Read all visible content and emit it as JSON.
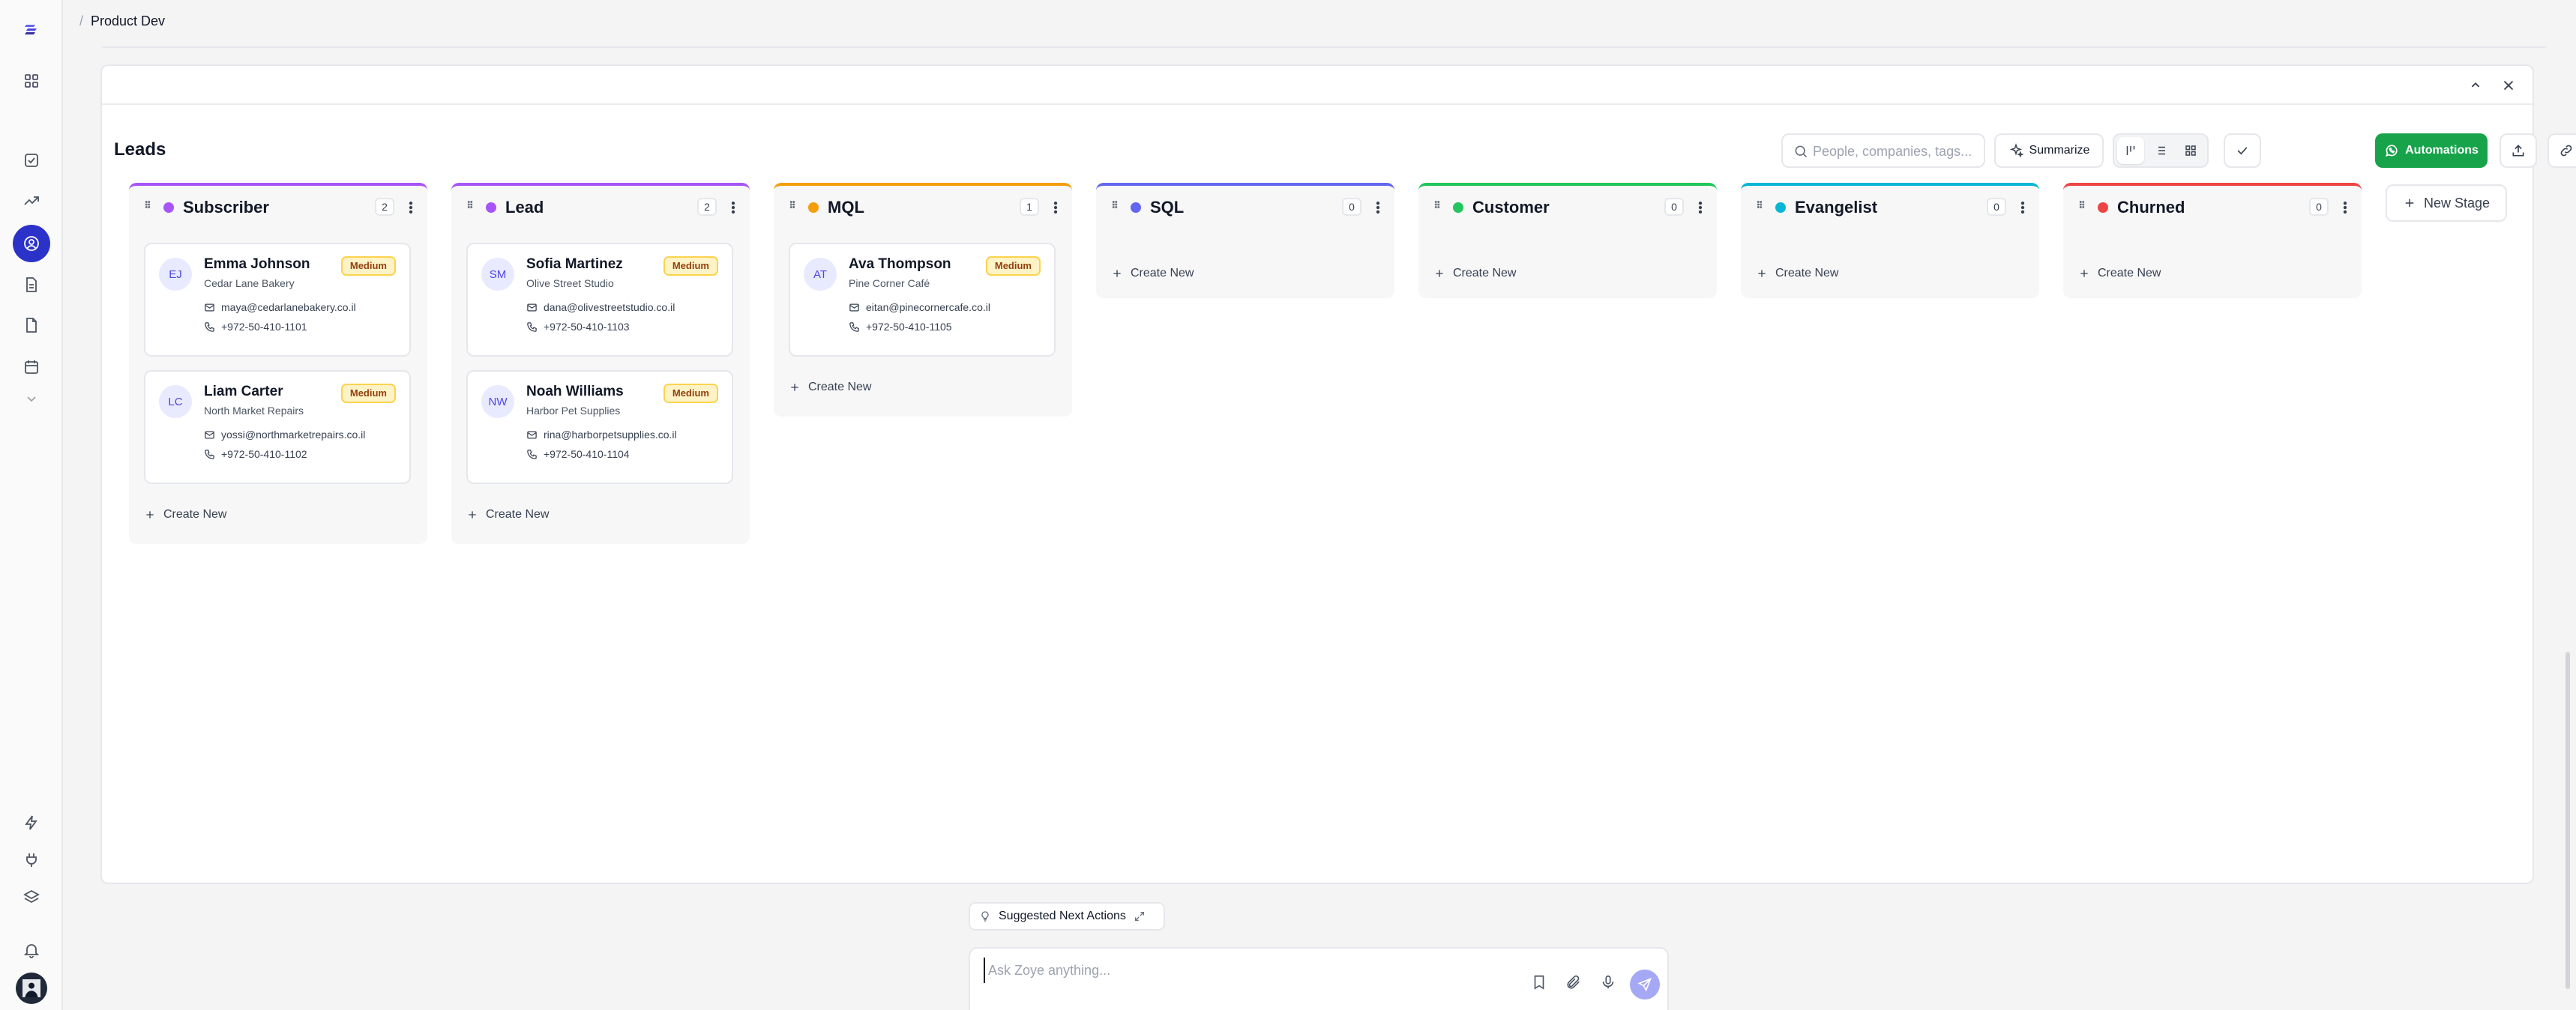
{
  "breadcrumb": {
    "separator": "/",
    "current": "Product Dev"
  },
  "page": {
    "title": "Leads"
  },
  "toolbar": {
    "search_placeholder": "People, companies, tags...",
    "summarize_label": "Summarize",
    "automations_label": "Automations",
    "automations_color": "#16a34a"
  },
  "columns": [
    {
      "name": "Subscriber",
      "count": "2",
      "color": "#a855f7",
      "cards": [
        {
          "initials": "EJ",
          "name": "Emma Johnson",
          "company": "Cedar Lane Bakery",
          "email": "maya@cedarlanebakery.co.il",
          "phone": "+972-50-410-1101",
          "priority": "Medium"
        },
        {
          "initials": "LC",
          "name": "Liam Carter",
          "company": "North Market Repairs",
          "email": "yossi@northmarketrepairs.co.il",
          "phone": "+972-50-410-1102",
          "priority": "Medium"
        }
      ],
      "create_label": "Create New"
    },
    {
      "name": "Lead",
      "count": "2",
      "color": "#a855f7",
      "cards": [
        {
          "initials": "SM",
          "name": "Sofia Martinez",
          "company": "Olive Street Studio",
          "email": "dana@olivestreetstudio.co.il",
          "phone": "+972-50-410-1103",
          "priority": "Medium"
        },
        {
          "initials": "NW",
          "name": "Noah Williams",
          "company": "Harbor Pet Supplies",
          "email": "rina@harborpetsupplies.co.il",
          "phone": "+972-50-410-1104",
          "priority": "Medium"
        }
      ],
      "create_label": "Create New"
    },
    {
      "name": "MQL",
      "count": "1",
      "color": "#f59e0b",
      "cards": [
        {
          "initials": "AT",
          "name": "Ava Thompson",
          "company": "Pine Corner Café",
          "email": "eitan@pinecornercafe.co.il",
          "phone": "+972-50-410-1105",
          "priority": "Medium"
        }
      ],
      "create_label": "Create New"
    },
    {
      "name": "SQL",
      "count": "0",
      "color": "#6366f1",
      "cards": [],
      "create_label": "Create New"
    },
    {
      "name": "Customer",
      "count": "0",
      "color": "#22c55e",
      "cards": [],
      "create_label": "Create New"
    },
    {
      "name": "Evangelist",
      "count": "0",
      "color": "#06b6d4",
      "cards": [],
      "create_label": "Create New"
    },
    {
      "name": "Churned",
      "count": "0",
      "color": "#ef4444",
      "cards": [],
      "create_label": "Create New"
    }
  ],
  "new_stage_label": "New Stage",
  "assistant": {
    "suggested_label": "Suggested Next Actions",
    "input_placeholder": "Ask Zoye anything..."
  },
  "rail": {
    "icons": [
      "logo-icon",
      "apps-grid-icon",
      "tasks-check-icon",
      "trending-icon",
      "contacts-icon",
      "documents-icon",
      "files-icon",
      "calendar-icon",
      "chevron-down-icon",
      "bolt-icon",
      "plug-icon",
      "layers-icon",
      "bell-icon"
    ],
    "active_color": "#2b32c8"
  }
}
